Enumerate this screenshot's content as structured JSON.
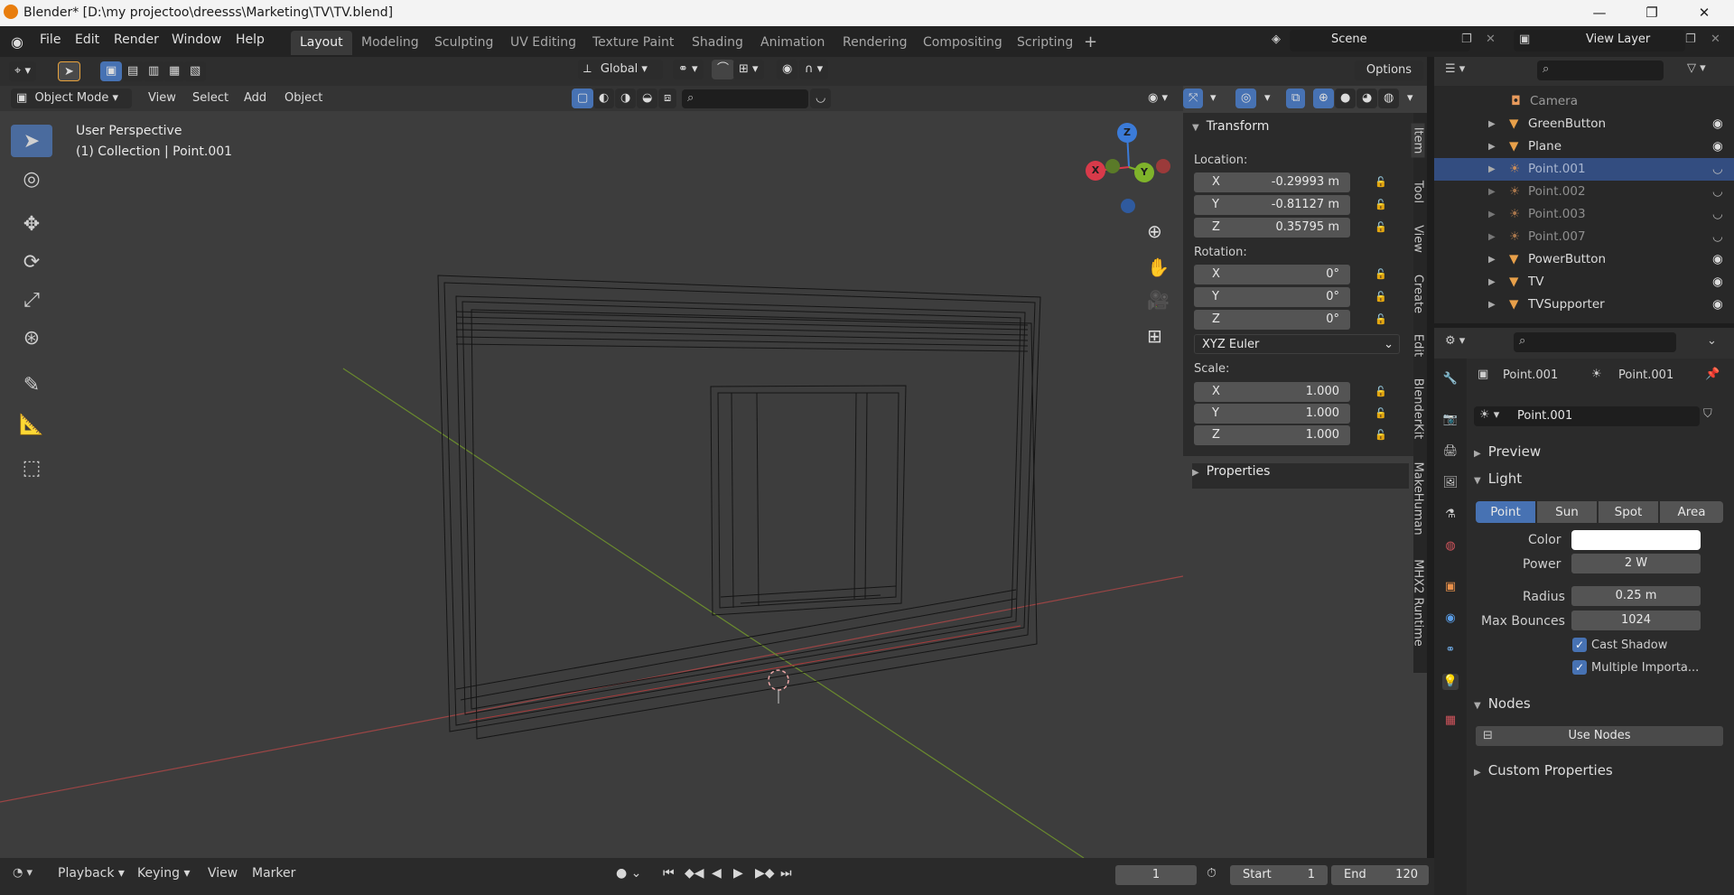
{
  "window": {
    "title": "Blender* [D:\\my projectoo\\dreesss\\Marketing\\TV\\TV.blend]",
    "minimize": "—",
    "maximize": "❐",
    "close": "✕"
  },
  "menu": [
    "File",
    "Edit",
    "Render",
    "Window",
    "Help"
  ],
  "workspaces": [
    "Layout",
    "Modeling",
    "Sculpting",
    "UV Editing",
    "Texture Paint",
    "Shading",
    "Animation",
    "Rendering",
    "Compositing",
    "Scripting"
  ],
  "active_workspace": "Layout",
  "scene": {
    "name": "Scene",
    "view_layer": "View Layer"
  },
  "viewport": {
    "orientation": "Global",
    "options": "Options",
    "mode": "Object Mode",
    "menus": [
      "View",
      "Select",
      "Add",
      "Object"
    ],
    "overlay_title": "User Perspective",
    "overlay_sub": "(1) Collection | Point.001"
  },
  "npanel": {
    "transform": "Transform",
    "location_label": "Location:",
    "location": [
      {
        "axis": "X",
        "value": "-0.29993 m"
      },
      {
        "axis": "Y",
        "value": "-0.81127 m"
      },
      {
        "axis": "Z",
        "value": "0.35795 m"
      }
    ],
    "rotation_label": "Rotation:",
    "rotation": [
      {
        "axis": "X",
        "value": "0°"
      },
      {
        "axis": "Y",
        "value": "0°"
      },
      {
        "axis": "Z",
        "value": "0°"
      }
    ],
    "rotation_mode": "XYZ Euler",
    "scale_label": "Scale:",
    "scale": [
      {
        "axis": "X",
        "value": "1.000"
      },
      {
        "axis": "Y",
        "value": "1.000"
      },
      {
        "axis": "Z",
        "value": "1.000"
      }
    ],
    "properties": "Properties",
    "tabs": [
      "Item",
      "Tool",
      "View",
      "Create",
      "Edit",
      "BlenderKit",
      "MakeHuman",
      "MHX2 Runtime"
    ]
  },
  "outliner": {
    "rows": [
      {
        "name": "Camera",
        "dim": true
      },
      {
        "name": "GreenButton",
        "dim": false
      },
      {
        "name": "Plane",
        "dim": false
      },
      {
        "name": "Point.001",
        "dim": true,
        "selected": true
      },
      {
        "name": "Point.002",
        "dim": true
      },
      {
        "name": "Point.003",
        "dim": true
      },
      {
        "name": "Point.007",
        "dim": true
      },
      {
        "name": "PowerButton",
        "dim": false
      },
      {
        "name": "TV",
        "dim": false
      },
      {
        "name": "TVSupporter",
        "dim": false
      }
    ]
  },
  "properties": {
    "breadcrumb_object": "Point.001",
    "breadcrumb_data": "Point.001",
    "datablock": "Point.001",
    "preview": "Preview",
    "light": "Light",
    "light_types": [
      "Point",
      "Sun",
      "Spot",
      "Area"
    ],
    "active_light_type": "Point",
    "color_label": "Color",
    "power_label": "Power",
    "power": "2 W",
    "radius_label": "Radius",
    "radius": "0.25 m",
    "bounces_label": "Max Bounces",
    "bounces": "1024",
    "cast_shadow": "Cast Shadow",
    "multiple_importance": "Multiple Importa...",
    "nodes": "Nodes",
    "use_nodes": "Use Nodes",
    "custom_properties": "Custom Properties",
    "colors": {
      "light_color": "#ffffff",
      "accent": "#4772b3"
    }
  },
  "timeline": {
    "menus": [
      "Playback",
      "Keying",
      "View",
      "Marker"
    ],
    "current_frame": "1",
    "start_label": "Start",
    "start": "1",
    "end_label": "End",
    "end": "120"
  },
  "gizmo": {
    "x": "X",
    "y": "Y",
    "z": "Z"
  }
}
